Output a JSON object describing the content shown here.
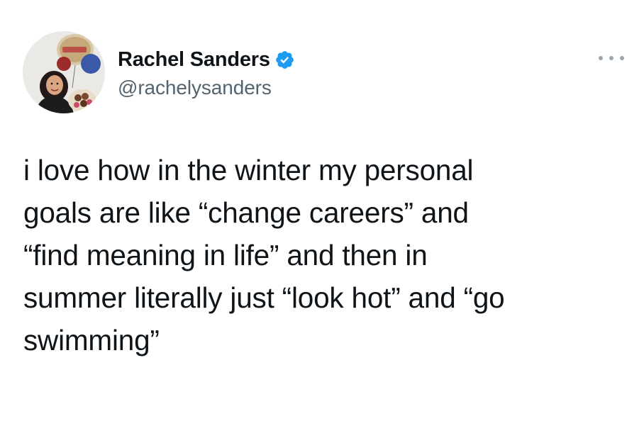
{
  "tweet": {
    "author": {
      "display_name": "Rachel Sanders",
      "handle": "@rachelysanders",
      "verified": true,
      "avatar_icon": "profile-photo"
    },
    "more_icon": "ellipsis-icon",
    "text": "i love how in the winter my personal\ngoals are like “change careers” and\n“find meaning in life” and then in\nsummer literally just “look hot” and “go\nswimming”"
  },
  "colors": {
    "text_primary": "#0f1419",
    "text_secondary": "#536471",
    "verified_blue": "#1d9bf0",
    "background": "#ffffff"
  }
}
